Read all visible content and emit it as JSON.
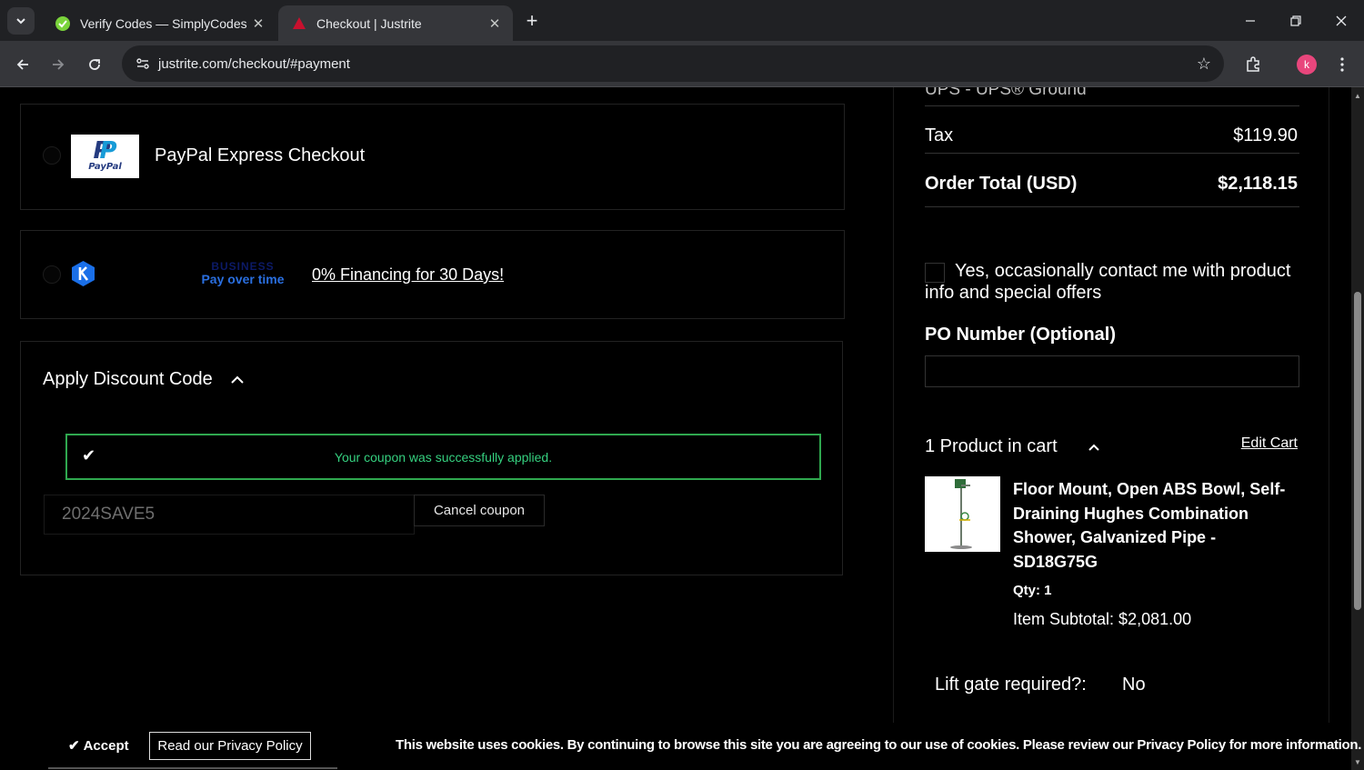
{
  "browser": {
    "tabs": [
      {
        "title": "Verify Codes — SimplyCodes",
        "active": false
      },
      {
        "title": "Checkout | Justrite",
        "active": true
      }
    ],
    "url": "justrite.com/checkout/#payment",
    "profile_initial": "k"
  },
  "payment": {
    "paypal_label": "PayPal Express Checkout",
    "paypal_logo_text": "PayPal",
    "bpot_line1": "BUSINESS",
    "bpot_line2": "Pay over time",
    "financing_link": "0% Financing for 30 Days!"
  },
  "discount": {
    "title": "Apply Discount Code",
    "success_message": "Your coupon was successfully applied.",
    "code_value": "2024SAVE5",
    "cancel_label": "Cancel coupon"
  },
  "summary": {
    "shipping_method": "UPS - UPS® Ground",
    "tax_label": "Tax",
    "tax_value": "$119.90",
    "total_label": "Order Total (USD)",
    "total_value": "$2,118.15",
    "optin_text": "Yes, occasionally contact me with product info and special offers",
    "po_label": "PO Number (Optional)",
    "cart_count": "1 Product in cart",
    "edit_cart": "Edit Cart",
    "product": {
      "name": "Floor Mount, Open ABS Bowl, Self-Draining Hughes Combination Shower, Galvanized Pipe - SD18G75G",
      "qty": "Qty: 1",
      "subtotal": "Item Subtotal: $2,081.00"
    },
    "lift_gate_label": "Lift gate required?:",
    "lift_gate_value": "No"
  },
  "cookie": {
    "accept": "Accept",
    "privacy_button": "Read our Privacy Policy",
    "message": "This website uses cookies. By continuing to browse this site you are agreeing to our use of cookies. Please review our Privacy Policy for more information."
  },
  "colors": {
    "success_border": "#2fa84f",
    "success_text": "#35d07f",
    "tab_active": "#35363a",
    "tabbar": "#202124"
  }
}
